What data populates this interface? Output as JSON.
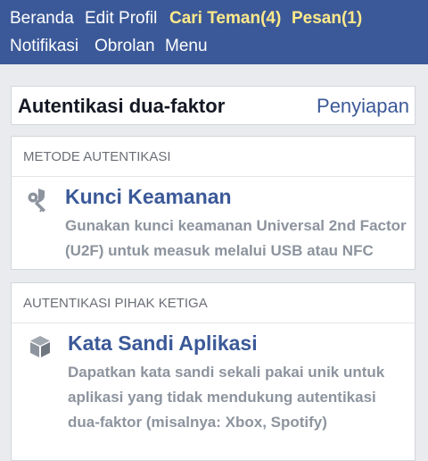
{
  "nav": {
    "row1": [
      {
        "label": "Beranda",
        "highlight": false
      },
      {
        "label": "Edit Profil",
        "highlight": false
      },
      {
        "label": "Cari Teman(4)",
        "highlight": true
      },
      {
        "label": "Pesan(1)",
        "highlight": true
      }
    ],
    "row2": [
      {
        "label": "Notifikasi"
      },
      {
        "label": "Obrolan"
      },
      {
        "label": "Menu"
      }
    ]
  },
  "header": {
    "title": "Autentikasi dua-faktor",
    "link": "Penyiapan"
  },
  "sections": [
    {
      "heading": "METODE AUTENTIKASI",
      "item": {
        "icon": "security-key-icon",
        "title": "Kunci Keamanan",
        "description": "Gunakan kunci keamanan Universal 2nd Factor (U2F) untuk measuk melalui USB atau NFC"
      }
    },
    {
      "heading": "AUTENTIKASI PIHAK KETIGA",
      "item": {
        "icon": "app-box-icon",
        "title": "Kata Sandi Aplikasi",
        "description": "Dapatkan kata sandi sekali pakai unik untuk aplikasi yang tidak mendukung autentikasi dua-faktor (misalnya: Xbox, Spotify)"
      }
    }
  ],
  "colors": {
    "nav_bg": "#3b5998",
    "nav_highlight": "#ffe98a",
    "link": "#3b5998",
    "muted_text": "#8d949e",
    "page_bg": "#e9ebee"
  }
}
